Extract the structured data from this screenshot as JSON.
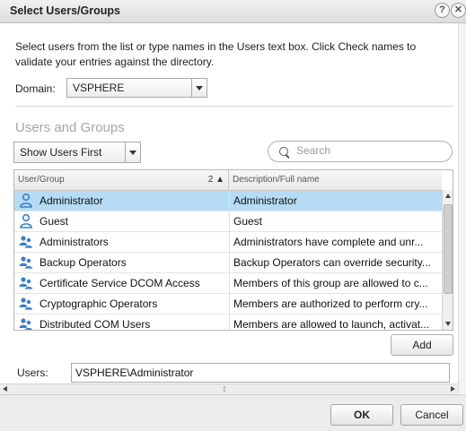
{
  "window": {
    "title": "Select Users/Groups"
  },
  "instructions": "Select users from the list or type names in the Users text box. Click Check names to validate your entries against the directory.",
  "domain": {
    "label": "Domain:",
    "value": "VSPHERE"
  },
  "section": {
    "title": "Users and Groups"
  },
  "filter": {
    "value": "Show Users First"
  },
  "search": {
    "placeholder": "Search"
  },
  "grid": {
    "columns": {
      "user_group": "User/Group",
      "description": "Description/Full name"
    },
    "sort_indicator": "2 ▲",
    "rows": [
      {
        "name": "Administrator",
        "description": "Administrator",
        "icon": "user-icon",
        "selected": true
      },
      {
        "name": "Guest",
        "description": "Guest",
        "icon": "user-icon",
        "selected": false
      },
      {
        "name": "Administrators",
        "description": "Administrators have complete and unr...",
        "icon": "group-icon",
        "selected": false
      },
      {
        "name": "Backup Operators",
        "description": "Backup Operators can override security...",
        "icon": "group-icon",
        "selected": false
      },
      {
        "name": "Certificate Service DCOM Access",
        "description": "Members of this group are allowed to c...",
        "icon": "group-icon",
        "selected": false
      },
      {
        "name": "Cryptographic Operators",
        "description": "Members are authorized to perform cry...",
        "icon": "group-icon",
        "selected": false
      },
      {
        "name": "Distributed COM Users",
        "description": "Members are allowed to launch, activat...",
        "icon": "group-icon",
        "selected": false
      }
    ]
  },
  "add_label": "Add",
  "users": {
    "label": "Users:",
    "value": "VSPHERE\\Administrator"
  },
  "footer": {
    "ok_label": "OK",
    "cancel_label": "Cancel"
  },
  "colors": {
    "selection": "#b6dcf5",
    "user_icon": "#3c7fc4"
  }
}
